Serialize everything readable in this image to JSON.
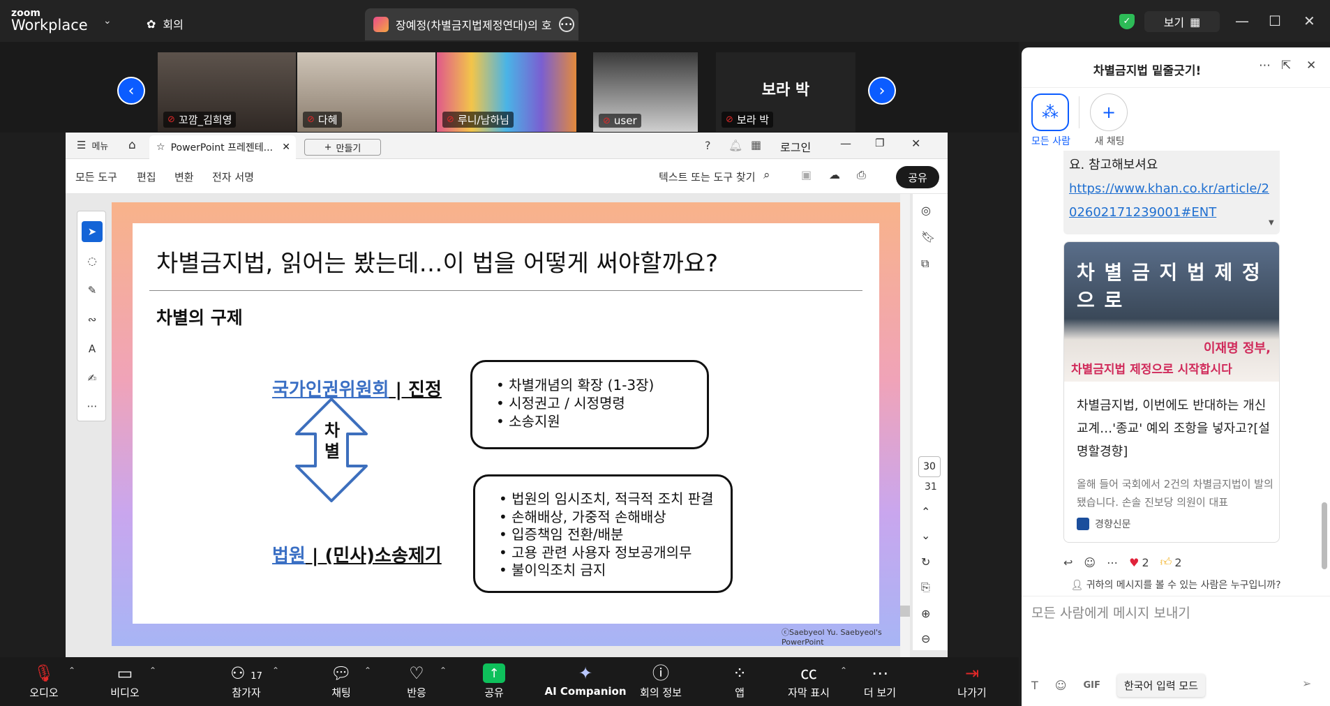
{
  "topbar": {
    "logo_top": "zoom",
    "logo_bottom": "Workplace",
    "meeting_menu_label": "회의",
    "tab_title": "장예정(차별금지법제정연대)의 호",
    "view_label": "보기"
  },
  "participants": [
    {
      "name": "꼬깜_김희영"
    },
    {
      "name": "다혜"
    },
    {
      "name": "루니/남하님"
    },
    {
      "name": "user"
    },
    {
      "name": "보라 박",
      "big_name": "보라 박"
    }
  ],
  "viewer": {
    "menu_label": "메뉴",
    "tab_title": "PowerPoint 프레젠테...",
    "new_label": "만들기",
    "login_label": "로그인",
    "menus": [
      "모든 도구",
      "편집",
      "변환",
      "전자 서명"
    ],
    "search_placeholder": "텍스트 또는 도구 찾기",
    "share_label": "공유",
    "page_current": "30",
    "page_total": "31"
  },
  "slide": {
    "title": "차별금지법, 읽어는 봤는데…이 법을 어떻게 써야할까요?",
    "subtitle": "차별의 구제",
    "org1_link": "국가인권위원회",
    "org1_rest": " | 진정",
    "org2_link": "법원",
    "org2_rest": " | (민사)소송제기",
    "arrow_label": "차\n별",
    "box1": [
      "• 차별개념의 확장 (1-3장)",
      "• 시정권고 / 시정명령",
      "• 소송지원"
    ],
    "box2": [
      "• 법원의 임시조치, 적극적 조치 판결",
      "• 손해배상, 가중적 손해배상",
      "• 입증책임 전환/배분",
      "• 고용 관련 사용자 정보공개의무",
      "• 불이익조치 금지"
    ],
    "copyright": "ⓒSaebyeol Yu. Saebyeol's PowerPoint"
  },
  "chat": {
    "title": "차별금지법 밑줄긋기!",
    "chip_all": "모든 사람",
    "chip_new": "새 채팅",
    "msg_text": "요. 참고해보셔요",
    "msg_link": "https://www.khan.co.kr/article/202602171239001#ENT",
    "card_title": "차별금지법, 이번에도 반대하는 개신교계…'종교' 예외 조항을 넣자고?[설명할경향]",
    "card_desc": "올해 들어 국회에서 2건의 차별금지법이 발의됐습니다. 손솔 진보당 의원이 대표",
    "card_source": "경향신문",
    "img_banner": "차 별 금 지 법 제 정 으 로",
    "img_text1": "이재명 정부,",
    "img_text2": "차별금지법 제정으로 시작합시다",
    "heart_count": "2",
    "thumb_count": "2",
    "visibility_text": "귀하의 메시지를 볼 수 있는 사람은 누구입니까?",
    "input_placeholder": "모든 사람에게 메시지 보내기",
    "gif_label": "GIF",
    "ime_label": "한국어 입력 모드"
  },
  "toolbar": {
    "audio": "오디오",
    "video": "비디오",
    "participants": "참가자",
    "participants_count": "17",
    "chat": "채팅",
    "react": "반응",
    "share": "공유",
    "ai": "AI Companion",
    "info": "회의 정보",
    "apps": "앱",
    "captions": "자막 표시",
    "more": "더 보기",
    "leave": "나가기"
  },
  "colors": {
    "zoom_blue": "#0b5cff",
    "share_green": "#0ec05b",
    "link_blue": "#3a6fc4"
  }
}
